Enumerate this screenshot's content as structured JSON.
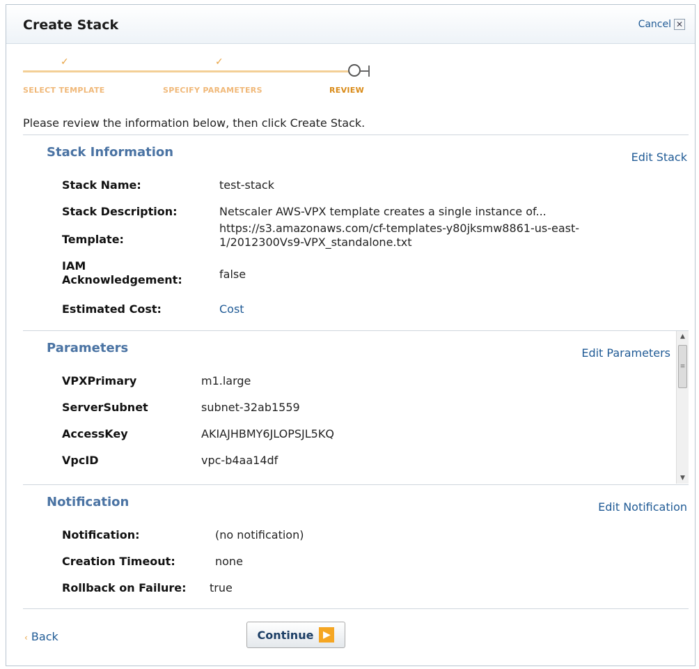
{
  "dialog": {
    "title": "Create Stack",
    "cancel_label": "Cancel",
    "cancel_icon": "close-icon"
  },
  "wizard": {
    "steps": [
      {
        "label": "SELECT TEMPLATE",
        "state": "done"
      },
      {
        "label": "SPECIFY PARAMETERS",
        "state": "done"
      },
      {
        "label": "REVIEW",
        "state": "current"
      }
    ],
    "colors": {
      "done": "#f0b878",
      "current": "#d98a17"
    }
  },
  "intro_text": "Please review the information below, then click Create Stack.",
  "stack_info": {
    "title": "Stack Information",
    "edit_label": "Edit Stack",
    "rows": [
      {
        "label": "Stack Name:",
        "value": "test-stack"
      },
      {
        "label": "Stack Description:",
        "value": "Netscaler AWS-VPX template creates a single instance of..."
      },
      {
        "label": "Template:",
        "value_line1": "https://s3.amazonaws.com/cf-templates-y80jksmw8861-us-east-",
        "value_line2": "1/2012300Vs9-VPX_standalone.txt"
      },
      {
        "label_line1": "IAM",
        "label_line2": "Acknowledgement:",
        "value": "false"
      },
      {
        "label": "Estimated Cost:",
        "value": "Cost"
      }
    ]
  },
  "parameters": {
    "title": "Parameters",
    "edit_label": "Edit Parameters",
    "rows": [
      {
        "label": "VPXPrimary",
        "value": "m1.large"
      },
      {
        "label": "ServerSubnet",
        "value": "subnet-32ab1559"
      },
      {
        "label": "AccessKey",
        "value": "AKIAJHBMY6JLOPSJL5KQ"
      },
      {
        "label": "VpcID",
        "value": "vpc-b4aa14df"
      }
    ]
  },
  "notification": {
    "title": "Notification",
    "edit_label": "Edit Notification",
    "rows": [
      {
        "label": "Notification:",
        "value": "(no notification)"
      },
      {
        "label": "Creation Timeout:",
        "value": "none"
      },
      {
        "label": "Rollback on Failure:",
        "value": "true"
      }
    ]
  },
  "footer": {
    "back_label": "Back",
    "continue_label": "Continue"
  },
  "colors": {
    "link": "#1f5a95",
    "section_title": "#4a73a3",
    "accent": "#f5a623"
  }
}
